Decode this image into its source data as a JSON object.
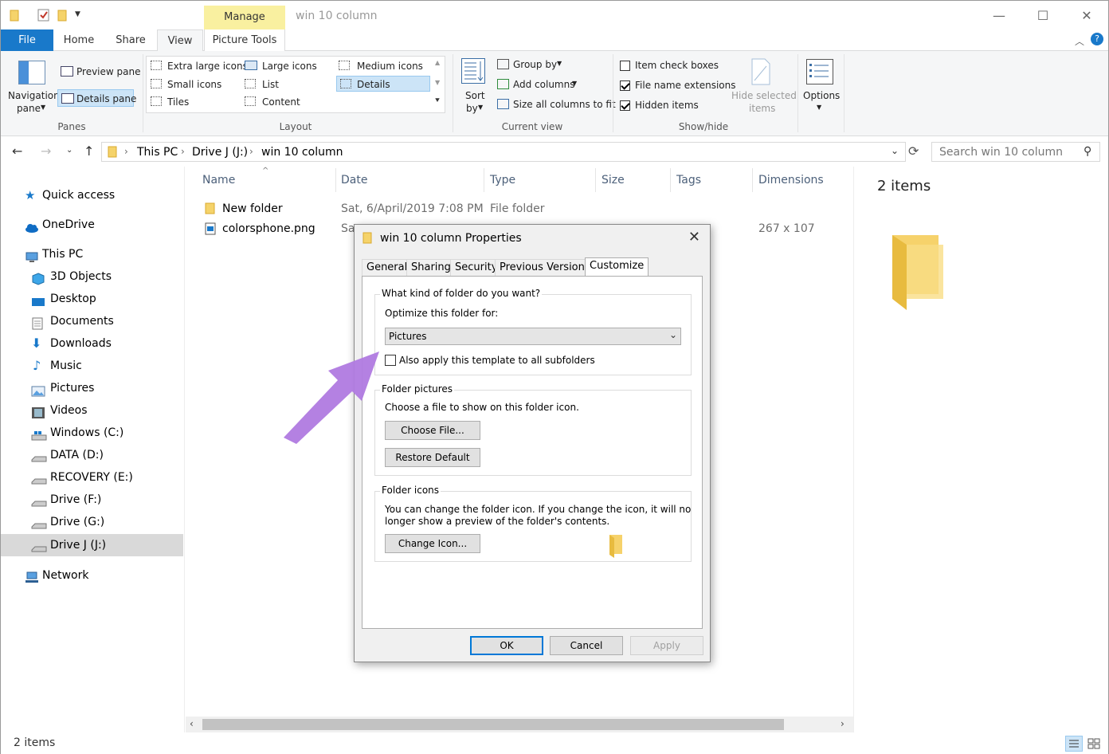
{
  "window": {
    "title": "win 10 column",
    "manage_tab": "Manage",
    "minimize": "—",
    "maximize": "☐",
    "close": "✕"
  },
  "ribbon_tabs": [
    "File",
    "Home",
    "Share",
    "View",
    "Picture Tools"
  ],
  "ribbon": {
    "panes": {
      "label": "Panes",
      "navigation_pane": "Navigation",
      "navigation_pane2": "pane",
      "preview_pane": "Preview pane",
      "details_pane": "Details pane"
    },
    "layout": {
      "label": "Layout",
      "extra_large_icons": "Extra large icons",
      "large_icons": "Large icons",
      "medium_icons": "Medium icons",
      "small_icons": "Small icons",
      "list": "List",
      "details": "Details",
      "tiles": "Tiles",
      "content": "Content"
    },
    "current_view": {
      "label": "Current view",
      "sort_by": "Sort",
      "sort_by2": "by",
      "group_by": "Group by",
      "add_columns": "Add columns",
      "size_all_columns": "Size all columns to fit"
    },
    "show_hide": {
      "label": "Show/hide",
      "item_check_boxes": "Item check boxes",
      "item_check_boxes_checked": false,
      "file_name_extensions": "File name extensions",
      "file_name_extensions_checked": true,
      "hidden_items": "Hidden items",
      "hidden_items_checked": true,
      "hide_selected_items": "Hide selected",
      "hide_selected_items2": "items"
    },
    "options": "Options"
  },
  "address": {
    "breadcrumb": [
      "This PC",
      "Drive J (J:)",
      "win 10 column"
    ],
    "search_placeholder": "Search win 10 column"
  },
  "nav_pane": {
    "items": [
      {
        "label": "Quick access",
        "icon": "star-icon"
      },
      {
        "label": "OneDrive",
        "icon": "cloud-icon"
      },
      {
        "label": "This PC",
        "icon": "computer-icon"
      },
      {
        "label": "3D Objects",
        "icon": "cube-icon"
      },
      {
        "label": "Desktop",
        "icon": "desktop-icon"
      },
      {
        "label": "Documents",
        "icon": "document-icon"
      },
      {
        "label": "Downloads",
        "icon": "download-icon"
      },
      {
        "label": "Music",
        "icon": "music-icon"
      },
      {
        "label": "Pictures",
        "icon": "pictures-icon"
      },
      {
        "label": "Videos",
        "icon": "videos-icon"
      },
      {
        "label": "Windows (C:)",
        "icon": "windows-drive-icon"
      },
      {
        "label": "DATA (D:)",
        "icon": "drive-icon"
      },
      {
        "label": "RECOVERY (E:)",
        "icon": "drive-icon"
      },
      {
        "label": "Drive (F:)",
        "icon": "drive-icon"
      },
      {
        "label": "Drive (G:)",
        "icon": "drive-icon"
      },
      {
        "label": "Drive J (J:)",
        "icon": "drive-icon"
      },
      {
        "label": "Network",
        "icon": "network-icon"
      }
    ]
  },
  "file_list": {
    "columns": [
      "Name",
      "Date",
      "Type",
      "Size",
      "Tags",
      "Dimensions"
    ],
    "rows": [
      {
        "name": "New folder",
        "date": "Sat, 6/April/2019  7:08 PM",
        "type": "File folder",
        "size": "",
        "tags": "",
        "dimensions": ""
      },
      {
        "name": "colorsphone.png",
        "date": "Sa",
        "type": "",
        "size": "",
        "tags": "",
        "dimensions": "267 x 107"
      }
    ]
  },
  "details_pane": {
    "count": "2 items"
  },
  "status": {
    "count": "2 items"
  },
  "dialog": {
    "title": "win 10 column Properties",
    "tabs": [
      "General",
      "Sharing",
      "Security",
      "Previous Versions",
      "Customize"
    ],
    "active_tab": "Customize",
    "kind_legend": "What kind of folder do you want?",
    "optimize_label": "Optimize this folder for:",
    "optimize_value": "Pictures",
    "apply_subfolders": "Also apply this template to all subfolders",
    "apply_subfolders_checked": false,
    "pictures_legend": "Folder pictures",
    "pictures_desc": "Choose a file to show on this folder icon.",
    "choose_file": "Choose File...",
    "restore_default": "Restore Default",
    "icons_legend": "Folder icons",
    "icons_desc1": "You can change the folder icon. If you change the icon, it will no",
    "icons_desc2": "longer show a preview of the folder's contents.",
    "change_icon": "Change Icon...",
    "ok": "OK",
    "cancel": "Cancel",
    "apply": "Apply"
  },
  "colors": {
    "file_tab": "#1979ca",
    "manage_tab": "#f9f0a0",
    "selection": "#cce4f7",
    "folder": "#f5d36a",
    "annotation_arrow": "#b07ae0"
  }
}
